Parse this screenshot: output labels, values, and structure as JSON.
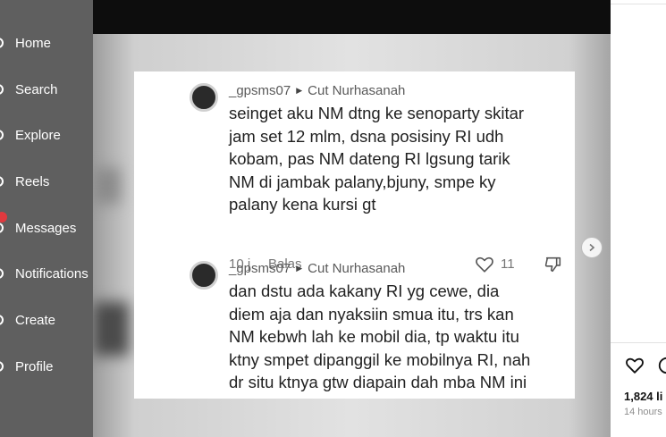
{
  "nav": {
    "items": [
      {
        "label": "Home",
        "icon": "home-icon"
      },
      {
        "label": "Search",
        "icon": "search-icon"
      },
      {
        "label": "Explore",
        "icon": "explore-icon"
      },
      {
        "label": "Reels",
        "icon": "reels-icon"
      },
      {
        "label": "Messages",
        "icon": "messages-icon",
        "badge": true
      },
      {
        "label": "Notifications",
        "icon": "heart-icon"
      },
      {
        "label": "Create",
        "icon": "plus-icon"
      },
      {
        "label": "Profile",
        "icon": "avatar-icon"
      }
    ]
  },
  "post": {
    "comments": [
      {
        "user": "_gpsms07",
        "reply_to": "Cut Nurhasanah",
        "text": "seinget aku NM dtng ke senoparty skitar\njam set 12 mlm, dsna posisiny RI udh\nkobam, pas NM dateng RI lgsung tarik\nNM di jambak palany,bjuny, smpe ky\npalany kena kursi gt",
        "time": "10 j",
        "reply_label": "Balas",
        "likes": "11"
      },
      {
        "user": "_gpsms07",
        "reply_to": "Cut Nurhasanah",
        "text": "dan dstu ada kakany RI yg cewe, dia\ndiem aja dan nyaksiin smua itu, trs kan\nNM kebwh lah ke mobil dia, tp waktu itu\nktny smpet dipanggil ke mobilnya RI, nah\ndr situ ktnya gtw diapain dah mba NM ini"
      }
    ]
  },
  "sidebar_right": {
    "likes": "1,824 li",
    "time_ago": "14 hours"
  },
  "colors": {
    "nav_bg": "#5f5f5f",
    "badge": "#e0393e"
  }
}
